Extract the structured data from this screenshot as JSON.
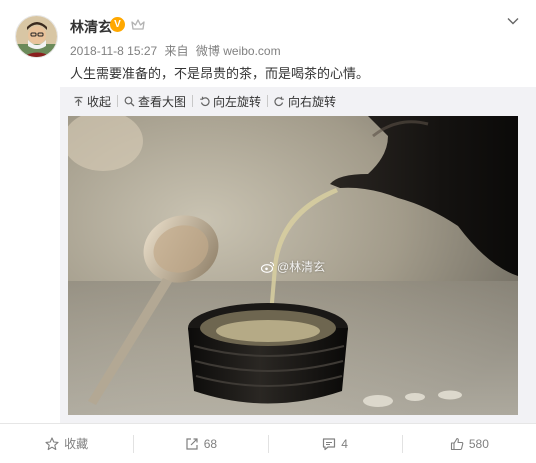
{
  "post": {
    "author": "林清玄",
    "verified_mark": "V",
    "date": "2018-11-8 15:27",
    "source_prefix": "来自",
    "source_app": "微博 weibo.com",
    "text": "人生需要准备的，不是昂贵的茶，而是喝茶的心情。"
  },
  "media_toolbar": {
    "collapse": "收起",
    "view_large": "查看大图",
    "rotate_left": "向左旋转",
    "rotate_right": "向右旋转"
  },
  "image": {
    "watermark": "@林清玄"
  },
  "actions": {
    "favorite": "收藏",
    "repost_count": "68",
    "comment_count": "4",
    "like_count": "580"
  },
  "colors": {
    "accent_verified": "#ffa800",
    "meta_text": "#808080",
    "media_bg": "#f2f2f5"
  }
}
